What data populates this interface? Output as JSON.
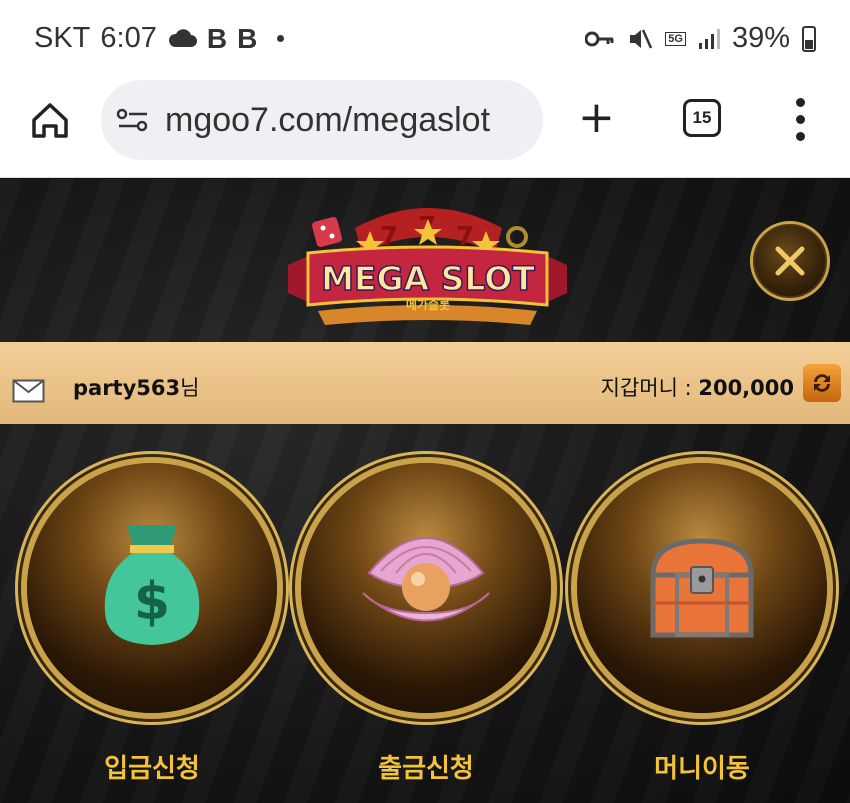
{
  "status_bar": {
    "carrier": "SKT",
    "time": "6:07",
    "notif_b1": "B",
    "notif_b2": "B",
    "network": "5G",
    "battery": "39%"
  },
  "browser": {
    "url": "mgoo7.com/megaslot",
    "tab_count": "15"
  },
  "header": {
    "logo_text": "MEGA SLOT",
    "logo_sub": "메가슬롯"
  },
  "account": {
    "username": "party563",
    "honorific": "님",
    "wallet_label": "지갑머니 : ",
    "wallet_amount": "200,000"
  },
  "menu": [
    {
      "label": "입금신청",
      "icon": "money-bag-icon"
    },
    {
      "label": "출금신청",
      "icon": "pearl-shell-icon"
    },
    {
      "label": "머니이동",
      "icon": "treasure-chest-icon"
    }
  ],
  "colors": {
    "accent_gold": "#f4c338",
    "infobar": "#e8bd82",
    "ring": "#c9a24a"
  }
}
